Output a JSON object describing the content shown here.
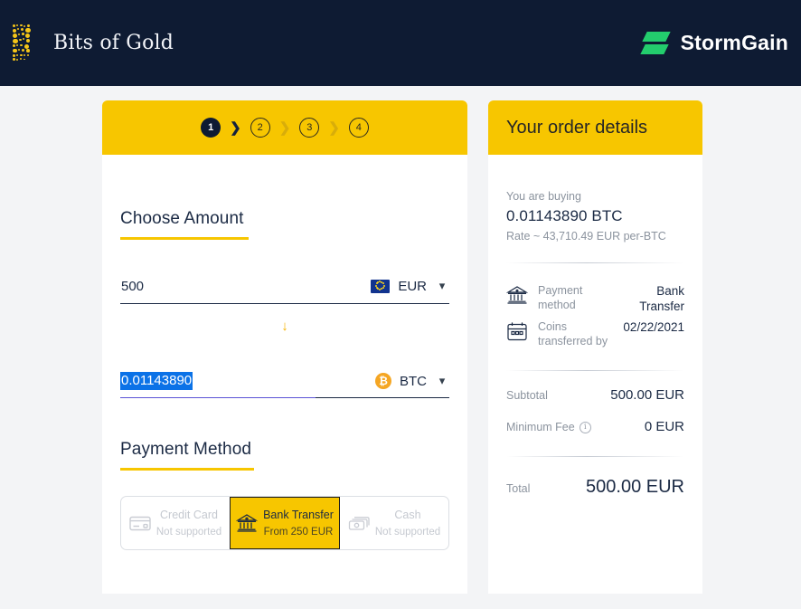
{
  "header": {
    "brand_name": "Bits of Gold",
    "partner_name": "StormGain",
    "brand_logo_icon": "bits-of-gold-dots-logo",
    "partner_logo_icon": "stormgain-bolt-logo",
    "background_color": "#0e1b33",
    "accent_color": "#f7c600"
  },
  "steps": {
    "items": [
      {
        "label": "1",
        "state": "active"
      },
      {
        "label": "2",
        "state": "idle"
      },
      {
        "label": "3",
        "state": "idle"
      },
      {
        "label": "4",
        "state": "idle"
      }
    ],
    "separator": "❯"
  },
  "amount": {
    "title": "Choose Amount",
    "fiat": {
      "value": "500",
      "placeholder": "0",
      "currency": "EUR",
      "flag_icon": "eu-flag-icon",
      "caret_icon": "chevron-down-icon"
    },
    "swap_icon": "arrow-down-icon",
    "crypto": {
      "value": "0.01143890",
      "placeholder": "0.00000000",
      "currency": "BTC",
      "coin_icon": "bitcoin-icon",
      "coin_glyph": "₿",
      "caret_icon": "chevron-down-icon",
      "selected": true,
      "selection_color": "#0b72e7"
    }
  },
  "payment": {
    "title": "Payment Method",
    "options": [
      {
        "label": "Credit Card",
        "sub": "Not supported",
        "icon": "credit-card-icon",
        "state": "disabled"
      },
      {
        "label": "Bank Transfer",
        "sub": "From 250 EUR",
        "icon": "bank-icon",
        "state": "selected"
      },
      {
        "label": "Cash",
        "sub": "Not supported",
        "icon": "banknotes-icon",
        "state": "disabled"
      }
    ]
  },
  "order": {
    "title": "Your order details",
    "buying_label": "You are buying",
    "buying_amount": "0.01143890 BTC",
    "rate": "Rate ~ 43,710.49 EUR per-BTC",
    "details": [
      {
        "icon": "bank-icon",
        "key": "Payment method",
        "value": "Bank Transfer",
        "highlighted": false
      },
      {
        "icon": "calendar-icon",
        "key": "Coins transferred by",
        "value": "02/22/2021",
        "highlighted": true,
        "highlight_color": "#fff500"
      }
    ],
    "lines": [
      {
        "key": "Subtotal",
        "value": "500.00 EUR",
        "info_icon": false
      },
      {
        "key": "Minimum Fee",
        "value": "0 EUR",
        "info_icon": true
      }
    ],
    "total": {
      "key": "Total",
      "value": "500.00 EUR"
    }
  }
}
